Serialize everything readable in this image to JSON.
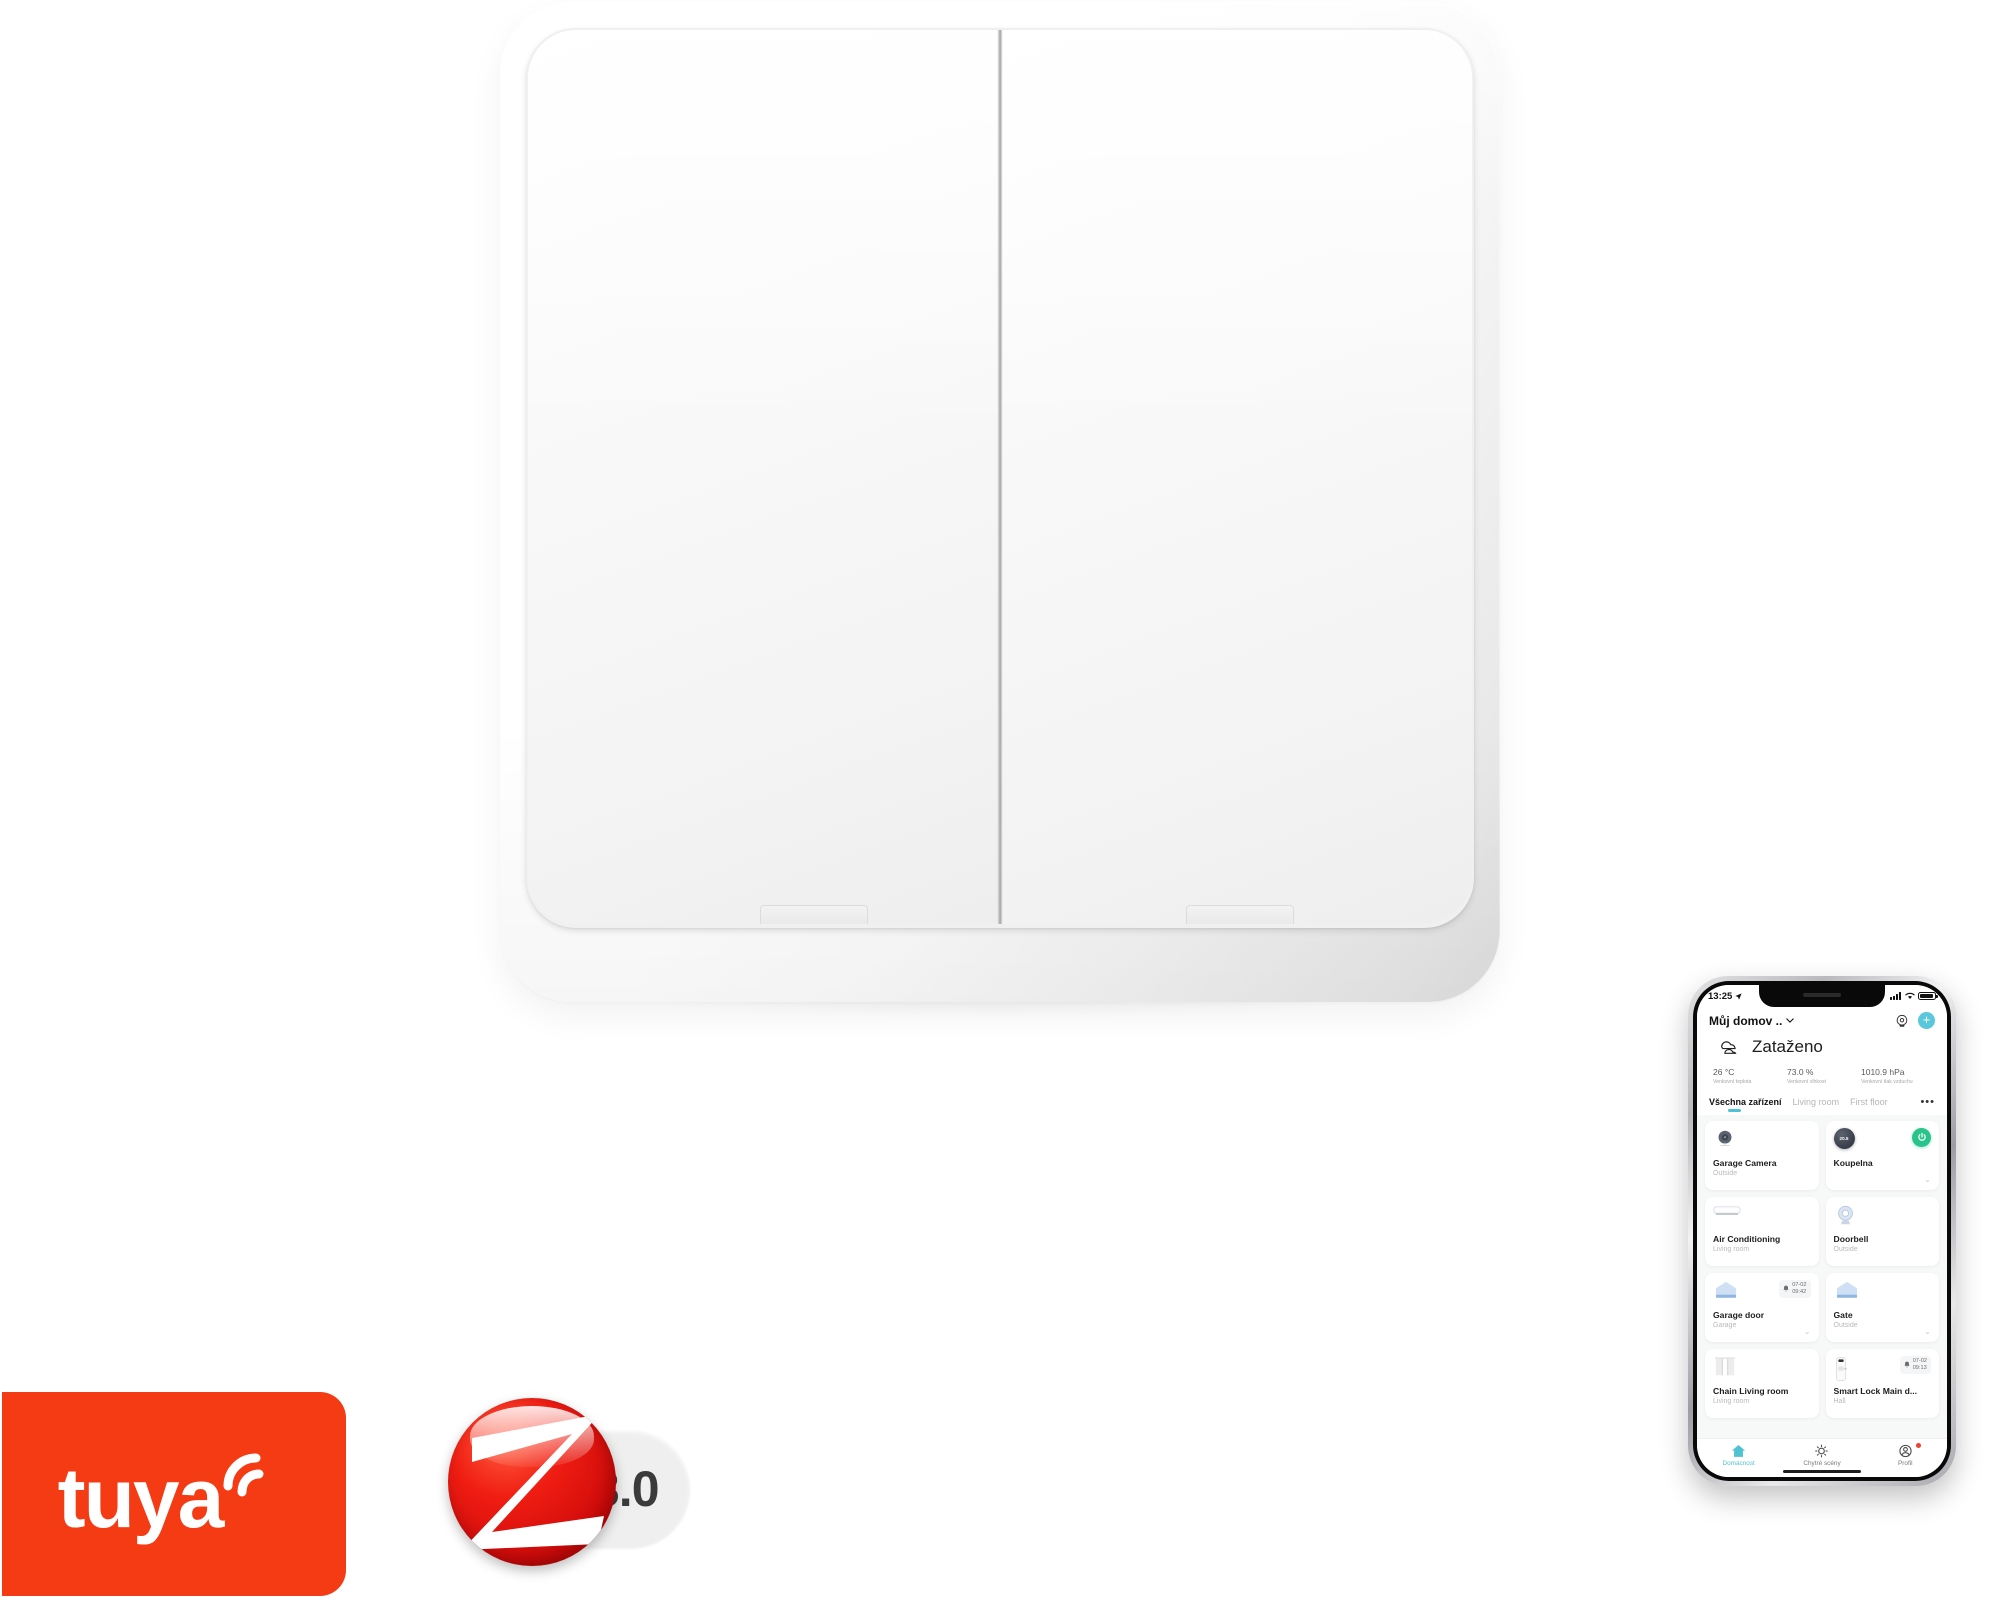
{
  "product": {
    "name": "smart-wall-switch",
    "type": "double rocker wall switch",
    "color": "white",
    "buttons": 2
  },
  "tuya_logo": {
    "wordmark": "tuya",
    "icon": "wifi-signal-icon",
    "background_color": "#f43b14",
    "text_color": "#ffffff"
  },
  "zigbee_logo": {
    "letter": "Z",
    "version": "3.0",
    "sphere_color": "#e01b10",
    "version_text_color": "#3b3b3b"
  },
  "phone": {
    "statusbar": {
      "time": "13:25",
      "location_icon": "location-arrow-icon",
      "signal_icon": "cellular-signal-icon",
      "wifi_icon": "wifi-icon",
      "battery_icon": "battery-icon"
    },
    "header": {
      "home_name": "Můj domov ..",
      "chevron_icon": "chevron-down-icon",
      "camera_icon": "camera-monitor-icon",
      "add_icon": "plus-icon",
      "add_button_color": "#5ac8dc"
    },
    "weather": {
      "icon": "cloudy-icon",
      "condition": "Zataženo",
      "metrics": [
        {
          "value": "26 °C",
          "label": "Venkovní teplota"
        },
        {
          "value": "73.0 %",
          "label": "Venkovní vlhkost"
        },
        {
          "value": "1010.9 hPa",
          "label": "Venkovní tlak vzduchu"
        }
      ]
    },
    "tabs": {
      "items": [
        {
          "label": "Všechna zařízení",
          "active": true
        },
        {
          "label": "Living room",
          "active": false
        },
        {
          "label": "First floor",
          "active": false
        }
      ],
      "more_label": "•••",
      "active_color": "#4fc3d4"
    },
    "devices": [
      {
        "title": "Garage Camera",
        "room": "Outside",
        "icon": "security-camera-icon",
        "control": "none"
      },
      {
        "title": "Koupelna",
        "room": "",
        "icon": "thermostat-dial-icon",
        "dial_value": "20.5",
        "control": "power-toggle",
        "chevron": true,
        "toggle_color": "#29c48c"
      },
      {
        "title": "Air Conditioning",
        "room": "Living room",
        "icon": "air-conditioner-icon",
        "control": "none"
      },
      {
        "title": "Doorbell",
        "room": "Outside",
        "icon": "doorbell-camera-icon",
        "control": "none"
      },
      {
        "title": "Garage door",
        "room": "Garage",
        "icon": "garage-door-icon",
        "control": "none",
        "chevron": true,
        "timestamp": {
          "icon": "bell-icon",
          "date": "07-02",
          "time": "09:42"
        }
      },
      {
        "title": "Gate",
        "room": "Outside",
        "icon": "gate-icon",
        "control": "none",
        "chevron": true
      },
      {
        "title": "Chain Living room",
        "room": "Living room",
        "icon": "curtain-icon",
        "control": "none"
      },
      {
        "title": "Smart Lock Main d...",
        "room": "Hall",
        "icon": "smart-lock-icon",
        "control": "none",
        "timestamp": {
          "icon": "bell-icon",
          "date": "07-02",
          "time": "09:13"
        }
      }
    ],
    "tabbar": [
      {
        "label": "Domácnost",
        "icon": "home-icon",
        "active": true
      },
      {
        "label": "Chytré scény",
        "icon": "sun-scenes-icon",
        "active": false
      },
      {
        "label": "Profil",
        "icon": "profile-icon",
        "active": false,
        "badge": true
      }
    ]
  }
}
